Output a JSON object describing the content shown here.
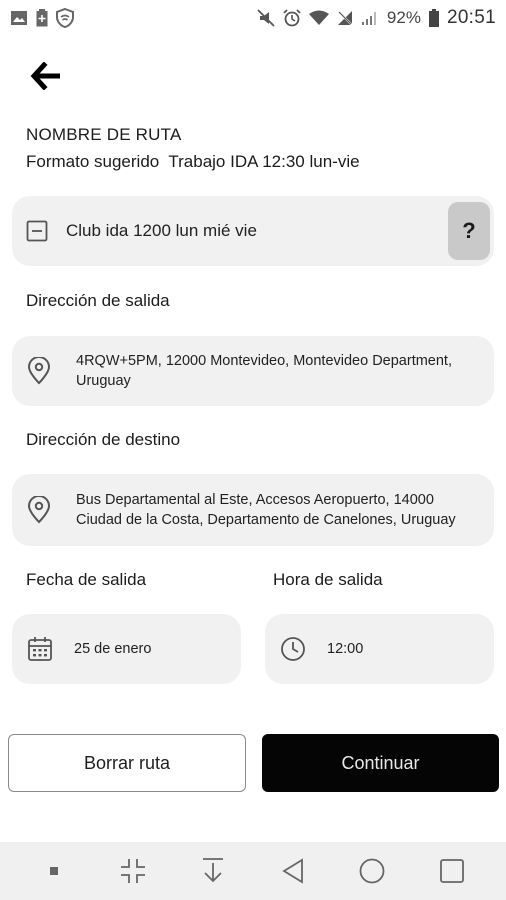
{
  "status_bar": {
    "battery_percent": "92%",
    "time": "20:51",
    "left_icons": [
      "image-icon",
      "battery-saver-icon",
      "shield-icon"
    ],
    "right_icons": [
      "mute-icon",
      "alarm-icon",
      "wifi-icon",
      "no-signal-icon",
      "signal-icon",
      "battery-icon"
    ]
  },
  "header": {
    "back_icon": "back-arrow-icon"
  },
  "route_name": {
    "heading": "NOMBRE DE RUTA",
    "hint": "Formato sugerido  Trabajo IDA 12:30 lun-vie",
    "value": "Club ida 1200 lun mié vie",
    "help_label": "?"
  },
  "departure": {
    "label": "Dirección de salida",
    "address": "4RQW+5PM, 12000 Montevideo, Montevideo Department, Uruguay"
  },
  "destination": {
    "label": "Dirección de destino",
    "address": "Bus Departamental al Este, Accesos Aeropuerto, 14000 Ciudad de la Costa, Departamento de Canelones, Uruguay"
  },
  "date": {
    "label": "Fecha de salida",
    "value": "25 de enero"
  },
  "time": {
    "label": "Hora de salida",
    "value": "12:00"
  },
  "actions": {
    "clear_label": "Borrar ruta",
    "continue_label": "Continuar"
  },
  "colors": {
    "card_bg": "#f1f1f1",
    "primary_button": "#050505",
    "help_button": "#c9c9c9",
    "nav_bar": "#f0f0f0"
  },
  "nav_bar": {
    "icons": [
      "dot-icon",
      "collapse-icon",
      "download-icon",
      "nav-back-icon",
      "home-icon",
      "recents-icon"
    ]
  }
}
